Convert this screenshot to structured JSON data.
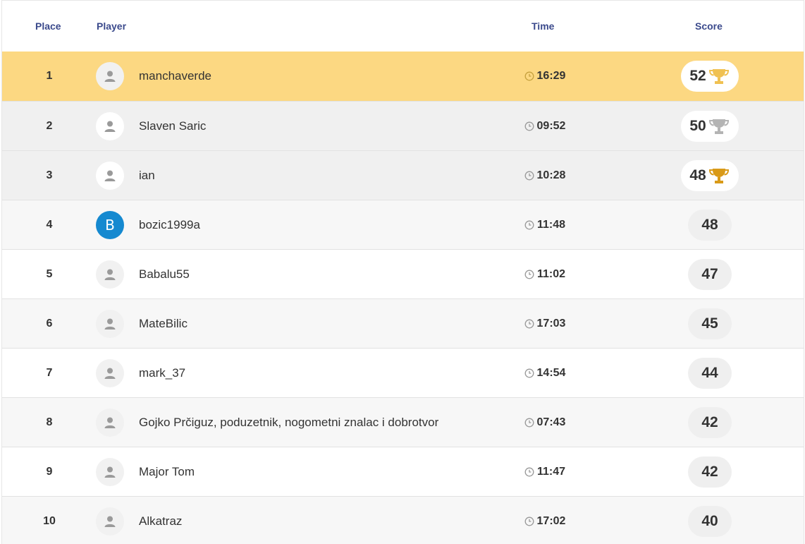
{
  "header": {
    "place": "Place",
    "player": "Player",
    "time": "Time",
    "score": "Score"
  },
  "colors": {
    "first_row": "#fcd882",
    "header_text": "#3b4a8c",
    "gold": "#e4a823",
    "silver": "#b4b4b4",
    "bronze": "#d99a18",
    "letter_avatar": "#1589d0"
  },
  "rows": [
    {
      "place": "1",
      "name": "manchaverde",
      "time": "16:29",
      "score": "52",
      "trophy": "trophy-gold-icon",
      "avatar": "user-icon"
    },
    {
      "place": "2",
      "name": "Slaven Saric",
      "time": "09:52",
      "score": "50",
      "trophy": "trophy-silver-icon",
      "avatar": "user-icon"
    },
    {
      "place": "3",
      "name": "ian",
      "time": "10:28",
      "score": "48",
      "trophy": "trophy-bronze-icon",
      "avatar": "user-icon"
    },
    {
      "place": "4",
      "name": "bozic1999a",
      "time": "11:48",
      "score": "48",
      "avatar_letter": "B"
    },
    {
      "place": "5",
      "name": "Babalu55",
      "time": "11:02",
      "score": "47",
      "avatar": "user-icon"
    },
    {
      "place": "6",
      "name": "MateBilic",
      "time": "17:03",
      "score": "45",
      "avatar": "user-icon"
    },
    {
      "place": "7",
      "name": "mark_37",
      "time": "14:54",
      "score": "44",
      "avatar": "user-icon"
    },
    {
      "place": "8",
      "name": "Gojko Prčiguz, poduzetnik, nogometni znalac i dobrotvor",
      "time": "07:43",
      "score": "42",
      "avatar": "user-icon"
    },
    {
      "place": "9",
      "name": "Major Tom",
      "time": "11:47",
      "score": "42",
      "avatar": "user-icon"
    },
    {
      "place": "10",
      "name": "Alkatraz",
      "time": "17:02",
      "score": "40",
      "avatar": "user-icon"
    }
  ]
}
